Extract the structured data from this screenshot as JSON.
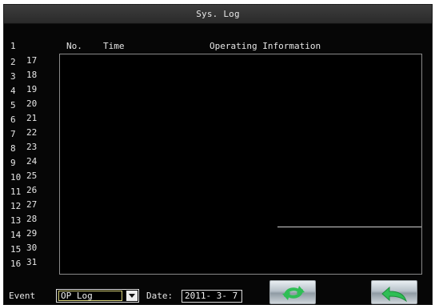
{
  "window": {
    "title": "Sys. Log"
  },
  "table": {
    "headers": {
      "index": "1",
      "no": "No.",
      "time": "Time",
      "operating_information": "Operating Information"
    },
    "left_numbers": [
      "2",
      "3",
      "4",
      "5",
      "6",
      "7",
      "8",
      "9",
      "10",
      "11",
      "12",
      "13",
      "14",
      "15",
      "16"
    ],
    "right_numbers": [
      "17",
      "18",
      "19",
      "20",
      "21",
      "22",
      "23",
      "24",
      "25",
      "26",
      "27",
      "28",
      "29",
      "30",
      "31"
    ]
  },
  "footer": {
    "event_label": "Event",
    "event_value": "OP Log",
    "date_label": "Date:",
    "date_value": "2011- 3- 7"
  },
  "icons": {
    "refresh": "refresh-icon",
    "back": "back-icon",
    "dropdown": "chevron-down-icon"
  },
  "colors": {
    "background": "#060606",
    "title_bar": "#333333",
    "text": "#e6e6e6",
    "button_icon": "#2fbe55",
    "select_highlight": "#d7d27a"
  }
}
